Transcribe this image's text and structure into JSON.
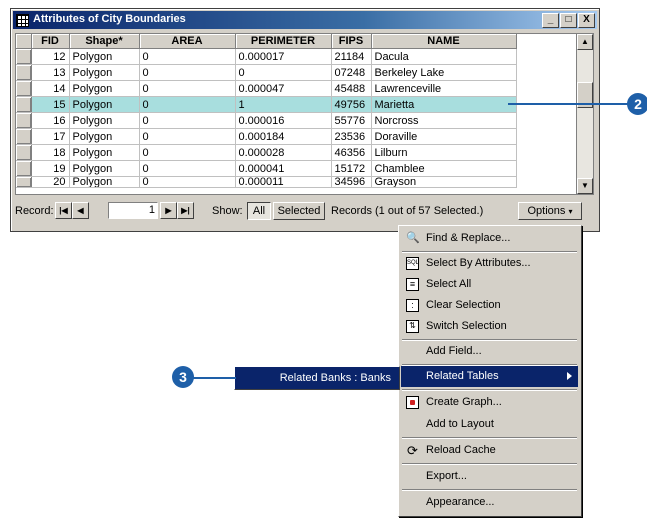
{
  "window": {
    "title": "Attributes of City Boundaries",
    "buttons": [
      "_",
      "□",
      "X"
    ]
  },
  "table": {
    "columns": [
      "FID",
      "Shape*",
      "AREA",
      "PERIMETER",
      "FIPS",
      "NAME"
    ],
    "rows": [
      {
        "fid": "12",
        "shape": "Polygon",
        "area": "0",
        "perimeter": "0.000017",
        "fips": "21184",
        "name": "Dacula"
      },
      {
        "fid": "13",
        "shape": "Polygon",
        "area": "0",
        "perimeter": "0",
        "fips": "07248",
        "name": "Berkeley Lake"
      },
      {
        "fid": "14",
        "shape": "Polygon",
        "area": "0",
        "perimeter": "0.000047",
        "fips": "45488",
        "name": "Lawrenceville"
      },
      {
        "fid": "15",
        "shape": "Polygon",
        "area": "0",
        "perimeter": "1",
        "fips": "49756",
        "name": "Marietta"
      },
      {
        "fid": "16",
        "shape": "Polygon",
        "area": "0",
        "perimeter": "0.000016",
        "fips": "55776",
        "name": "Norcross"
      },
      {
        "fid": "17",
        "shape": "Polygon",
        "area": "0",
        "perimeter": "0.000184",
        "fips": "23536",
        "name": "Doraville"
      },
      {
        "fid": "18",
        "shape": "Polygon",
        "area": "0",
        "perimeter": "0.000028",
        "fips": "46356",
        "name": "Lilburn"
      },
      {
        "fid": "19",
        "shape": "Polygon",
        "area": "0",
        "perimeter": "0.000041",
        "fips": "15172",
        "name": "Chamblee"
      },
      {
        "fid": "20",
        "shape": "Polygon",
        "area": "0",
        "perimeter": "0.000011",
        "fips": "34596",
        "name": "Grayson"
      }
    ],
    "selected_row_fid": "15",
    "highlight_color": "#a8dede"
  },
  "bottom": {
    "record_label": "Record:",
    "record_value": "1",
    "show_label": "Show:",
    "all_label": "All",
    "selected_label": "Selected",
    "records_status": "Records (1 out of 57 Selected.)",
    "options_label": "Options"
  },
  "menu": {
    "items": [
      {
        "label": "Find & Replace...",
        "icon": "binoculars-icon"
      },
      {
        "label": "Select By Attributes...",
        "icon": "sql-icon"
      },
      {
        "label": "Select All",
        "icon": "select-all-icon"
      },
      {
        "label": "Clear Selection",
        "icon": "clear-selection-icon"
      },
      {
        "label": "Switch Selection",
        "icon": "switch-selection-icon"
      },
      {
        "label": "Add Field...",
        "icon": ""
      },
      {
        "label": "Related Tables",
        "icon": ""
      },
      {
        "label": "Create Graph...",
        "icon": "graph-icon"
      },
      {
        "label": "Add to Layout",
        "icon": ""
      },
      {
        "label": "Reload Cache",
        "icon": "reload-icon"
      },
      {
        "label": "Export...",
        "icon": ""
      },
      {
        "label": "Appearance...",
        "icon": ""
      }
    ],
    "active_item": "Related Tables",
    "submenu_item": "Related Banks : Banks",
    "active_color": "#0a246a"
  },
  "callouts": [
    "2",
    "3"
  ],
  "callout_color": "#1e5fa8"
}
